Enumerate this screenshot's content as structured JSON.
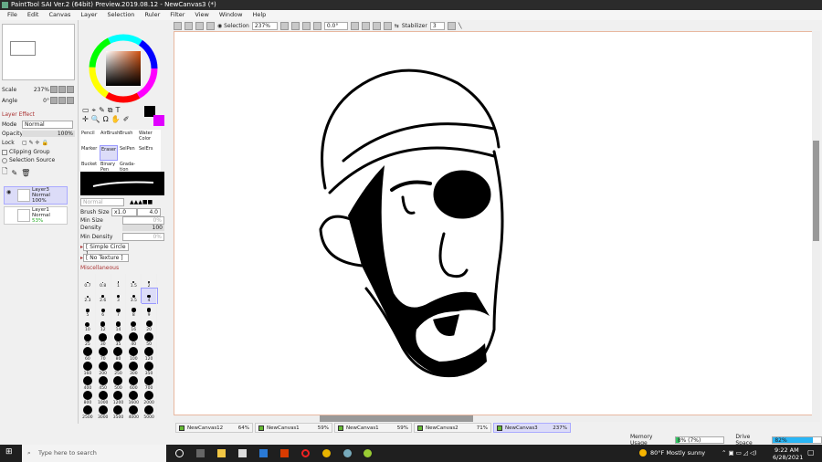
{
  "window": {
    "title": "PaintTool SAI Ver.2 (64bit) Preview.2019.08.12 - NewCanvas3 (*)"
  },
  "menu": [
    "File",
    "Edit",
    "Canvas",
    "Layer",
    "Selection",
    "Ruler",
    "Filter",
    "View",
    "Window",
    "Help"
  ],
  "navigator": {
    "scale_label": "Scale",
    "scale_value": "237%",
    "angle_label": "Angle",
    "angle_value": "0°"
  },
  "layer_panel": {
    "layer_effect": "Layer Effect",
    "mode_label": "Mode",
    "mode_value": "Normal",
    "opacity_label": "Opacity",
    "opacity_value": "100%",
    "lock_label": "Lock",
    "clipping_group": "Clipping Group",
    "selection_source": "Selection Source",
    "layers": [
      {
        "name": "Layer3",
        "mode": "Normal",
        "opacity": "100%",
        "selected": true
      },
      {
        "name": "Layer1",
        "mode": "Normal",
        "opacity": "53%",
        "selected": false
      }
    ]
  },
  "colors": {
    "primary": "#000000",
    "secondary": "#e000ff"
  },
  "brush_tools": [
    {
      "label": "Pencil"
    },
    {
      "label": "AirBrush"
    },
    {
      "label": "Brush"
    },
    {
      "label": "Water Color"
    },
    {
      "label": "Marker"
    },
    {
      "label": "Eraser",
      "selected": true
    },
    {
      "label": "SelPen"
    },
    {
      "label": "SelErs"
    },
    {
      "label": "Bucket"
    },
    {
      "label": "Binary Pen"
    },
    {
      "label": "Grada-tion"
    }
  ],
  "brush_settings": {
    "blend_mode": "Normal",
    "brush_size_label": "Brush Size",
    "brush_size_mult": "x1.0",
    "brush_size_value": "4.0",
    "min_size_label": "Min Size",
    "min_size_value": "0%",
    "density_label": "Density",
    "density_value": "100",
    "min_density_label": "Min Density",
    "min_density_value": "0%",
    "shape": "[ Simple Circle ]",
    "texture": "[ No Texture ]",
    "misc": "Miscellaneous"
  },
  "brush_sizes": [
    "0.7",
    "0.8",
    "1",
    "1.5",
    "2",
    "2.3",
    "2.6",
    "3",
    "3.5",
    "4",
    "5",
    "6",
    "7",
    "8",
    "9",
    "10",
    "12",
    "14",
    "16",
    "20",
    "25",
    "30",
    "35",
    "40",
    "50",
    "60",
    "70",
    "80",
    "100",
    "120",
    "160",
    "200",
    "250",
    "300",
    "350",
    "400",
    "450",
    "500",
    "600",
    "700",
    "800",
    "1000",
    "1200",
    "1600",
    "2000",
    "2500",
    "3000",
    "3500",
    "4000",
    "5000"
  ],
  "brush_size_selected": "4",
  "toolbar": {
    "selection_label": "Selection",
    "zoom": "237%",
    "rotation": "0.0°",
    "stabilizer_label": "Stabilizer",
    "stabilizer_value": "3"
  },
  "canvas_tabs": [
    {
      "name": "NewCanvas12",
      "zoom": "64%"
    },
    {
      "name": "NewCanvas1",
      "zoom": "59%"
    },
    {
      "name": "NewCanvas1",
      "zoom": "59%"
    },
    {
      "name": "NewCanvas2",
      "zoom": "71%"
    },
    {
      "name": "NewCanvas3",
      "zoom": "237%",
      "active": true
    }
  ],
  "status": {
    "memory_label": "Memory Usage",
    "memory_value": "8% (7%)",
    "memory_pct": 8,
    "drive_label": "Drive Space",
    "drive_value": "82%",
    "drive_pct": 82
  },
  "taskbar": {
    "search_placeholder": "Type here to search",
    "weather": "80°F  Mostly sunny",
    "time": "9:22 AM",
    "date": "6/28/2021"
  }
}
